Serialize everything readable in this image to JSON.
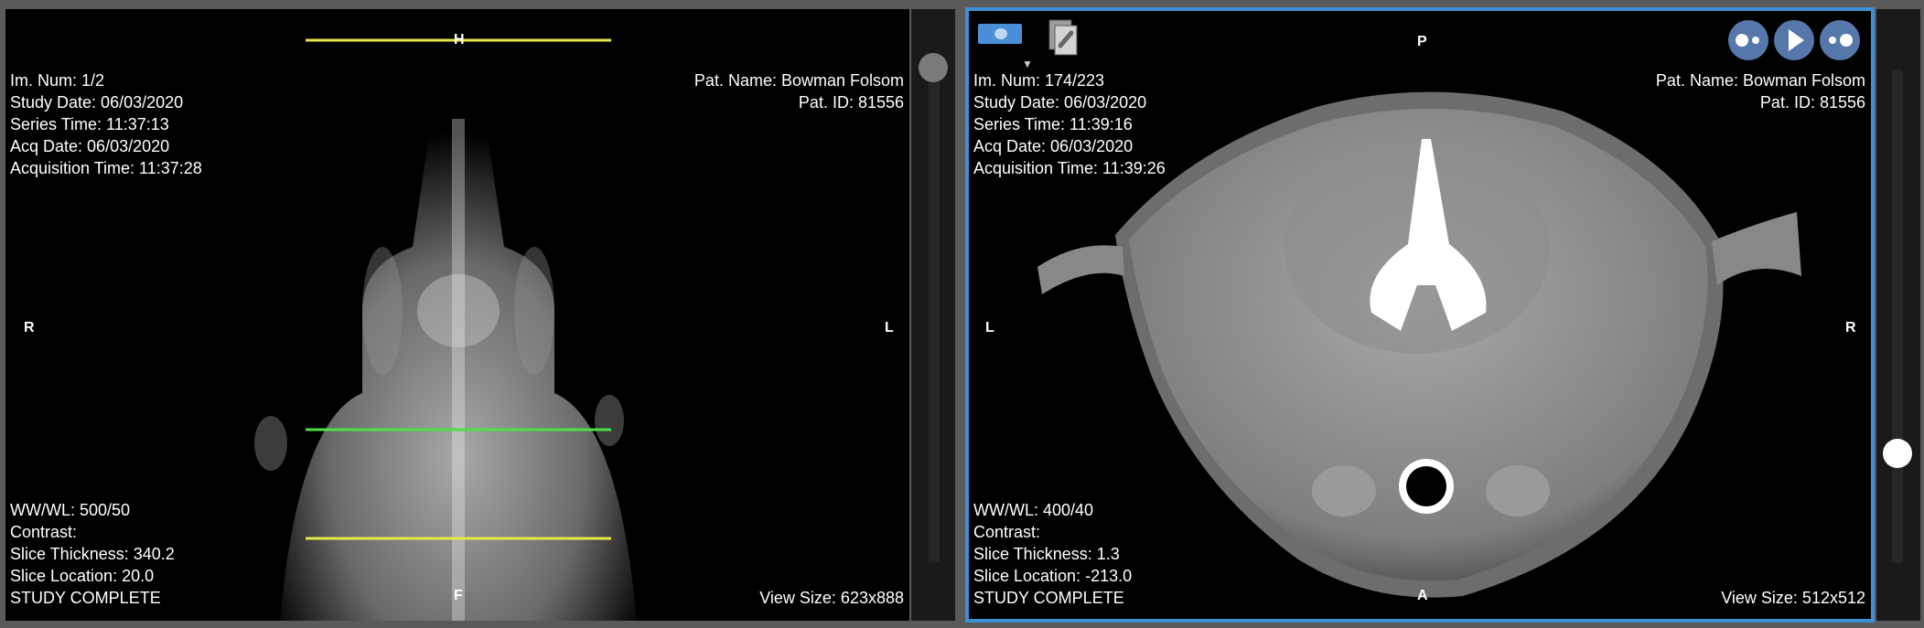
{
  "left_viewport": {
    "info_top_left": [
      "Im. Num: 1/2",
      "Study Date: 06/03/2020",
      "Series Time: 11:37:13",
      "Acq Date: 06/03/2020",
      "Acquisition Time: 11:37:28"
    ],
    "info_top_right": [
      "Pat. Name: Bowman Folsom",
      "Pat. ID: 81556"
    ],
    "info_bottom_left": [
      "WW/WL: 500/50",
      "Contrast:",
      "Slice Thickness: 340.2",
      "Slice Location: 20.0",
      "STUDY COMPLETE"
    ],
    "info_bottom_right": "View Size: 623x888",
    "orientation": {
      "top": "H",
      "bottom": "F",
      "left": "R",
      "right": "L"
    },
    "colors": {
      "reference_line": "#e8e84a",
      "active_slice_line": "#4ce04c"
    }
  },
  "right_viewport": {
    "info_top_left": [
      "Im. Num: 174/223",
      "Study Date: 06/03/2020",
      "Series Time: 11:39:16",
      "Acq Date: 06/03/2020",
      "Acquisition Time: 11:39:26"
    ],
    "info_top_right": [
      "Pat. Name: Bowman Folsom",
      "Pat. ID: 81556"
    ],
    "info_bottom_left": [
      "WW/WL: 400/40",
      "Contrast:",
      "Slice Thickness: 1.3",
      "Slice Location: -213.0",
      "STUDY COMPLETE"
    ],
    "info_bottom_right": "View Size: 512x512",
    "orientation": {
      "top": "P",
      "bottom": "A",
      "left": "L",
      "right": "R"
    },
    "toolbar_icons": [
      "window-level-icon",
      "link-icon",
      "previous-icon",
      "play-icon",
      "next-icon"
    ],
    "colors": {
      "active_border": "#3d8fd8"
    }
  }
}
